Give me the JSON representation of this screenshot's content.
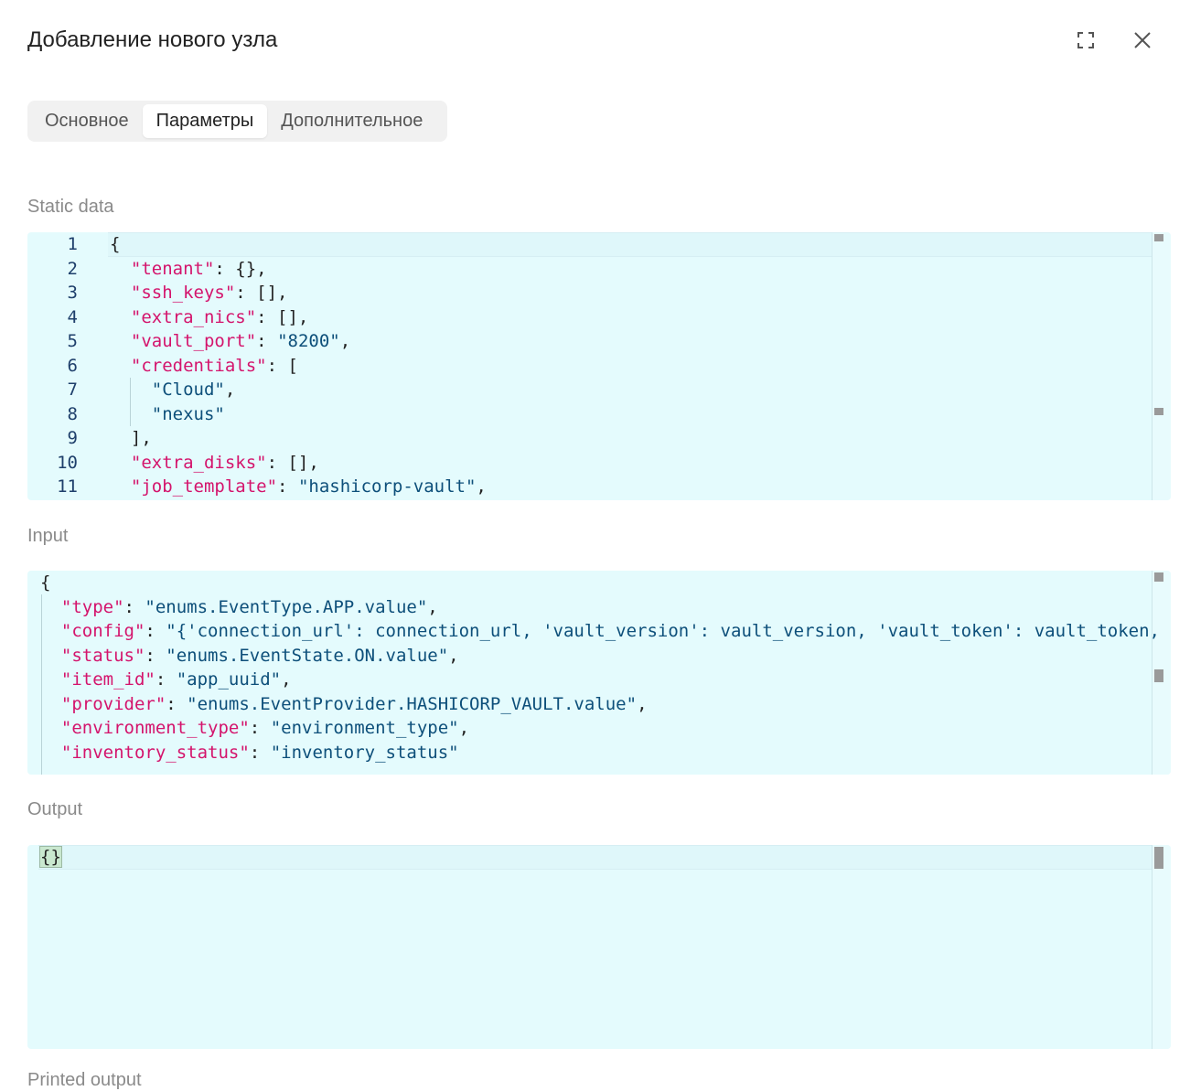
{
  "dialog": {
    "title": "Добавление нового узла",
    "icons": {
      "fullscreen": "fullscreen-icon",
      "close": "close-icon"
    }
  },
  "tabs": [
    {
      "label": "Основное",
      "active": false
    },
    {
      "label": "Параметры",
      "active": true
    },
    {
      "label": "Дополнительное",
      "active": false
    }
  ],
  "sections": {
    "static_data": {
      "label": "Static data",
      "line_numbers": [
        "1",
        "2",
        "3",
        "4",
        "5",
        "6",
        "7",
        "8",
        "9",
        "10",
        "11"
      ],
      "lines": [
        {
          "indent": "",
          "parts": [
            [
              "p",
              "{"
            ]
          ]
        },
        {
          "indent": "  ",
          "parts": [
            [
              "k",
              "\"tenant\""
            ],
            [
              "p",
              ": {},"
            ]
          ]
        },
        {
          "indent": "  ",
          "parts": [
            [
              "k",
              "\"ssh_keys\""
            ],
            [
              "p",
              ": [],"
            ]
          ]
        },
        {
          "indent": "  ",
          "parts": [
            [
              "k",
              "\"extra_nics\""
            ],
            [
              "p",
              ": [],"
            ]
          ]
        },
        {
          "indent": "  ",
          "parts": [
            [
              "k",
              "\"vault_port\""
            ],
            [
              "p",
              ": "
            ],
            [
              "s",
              "\"8200\""
            ],
            [
              "p",
              ","
            ]
          ]
        },
        {
          "indent": "  ",
          "parts": [
            [
              "k",
              "\"credentials\""
            ],
            [
              "p",
              ": ["
            ]
          ]
        },
        {
          "indent": "    ",
          "parts": [
            [
              "s",
              "\"Cloud\""
            ],
            [
              "p",
              ","
            ]
          ]
        },
        {
          "indent": "    ",
          "parts": [
            [
              "s",
              "\"nexus\""
            ]
          ]
        },
        {
          "indent": "  ",
          "parts": [
            [
              "p",
              "],"
            ]
          ]
        },
        {
          "indent": "  ",
          "parts": [
            [
              "k",
              "\"extra_disks\""
            ],
            [
              "p",
              ": [],"
            ]
          ]
        },
        {
          "indent": "  ",
          "parts": [
            [
              "k",
              "\"job_template\""
            ],
            [
              "p",
              ": "
            ],
            [
              "s",
              "\"hashicorp-vault\""
            ],
            [
              "p",
              ","
            ]
          ]
        }
      ]
    },
    "input": {
      "label": "Input",
      "lines": [
        {
          "indent": "",
          "parts": [
            [
              "p",
              "{"
            ]
          ]
        },
        {
          "indent": "  ",
          "parts": [
            [
              "k",
              "\"type\""
            ],
            [
              "p",
              ": "
            ],
            [
              "s",
              "\"enums.EventType.APP.value\""
            ],
            [
              "p",
              ","
            ]
          ]
        },
        {
          "indent": "  ",
          "parts": [
            [
              "k",
              "\"config\""
            ],
            [
              "p",
              ": "
            ],
            [
              "s",
              "\"{'connection_url': connection_url, 'vault_version': vault_version, 'vault_token': vault_token, 'vault_"
            ]
          ]
        },
        {
          "indent": "  ",
          "parts": [
            [
              "k",
              "\"status\""
            ],
            [
              "p",
              ": "
            ],
            [
              "s",
              "\"enums.EventState.ON.value\""
            ],
            [
              "p",
              ","
            ]
          ]
        },
        {
          "indent": "  ",
          "parts": [
            [
              "k",
              "\"item_id\""
            ],
            [
              "p",
              ": "
            ],
            [
              "s",
              "\"app_uuid\""
            ],
            [
              "p",
              ","
            ]
          ]
        },
        {
          "indent": "  ",
          "parts": [
            [
              "k",
              "\"provider\""
            ],
            [
              "p",
              ": "
            ],
            [
              "s",
              "\"enums.EventProvider.HASHICORP_VAULT.value\""
            ],
            [
              "p",
              ","
            ]
          ]
        },
        {
          "indent": "  ",
          "parts": [
            [
              "k",
              "\"environment_type\""
            ],
            [
              "p",
              ": "
            ],
            [
              "s",
              "\"environment_type\""
            ],
            [
              "p",
              ","
            ]
          ]
        },
        {
          "indent": "  ",
          "parts": [
            [
              "k",
              "\"inventory_status\""
            ],
            [
              "p",
              ": "
            ],
            [
              "s",
              "\"inventory_status\""
            ]
          ]
        }
      ]
    },
    "output": {
      "label": "Output",
      "lines": [
        {
          "indent": "",
          "parts": [
            [
              "p",
              "{}"
            ]
          ]
        }
      ]
    },
    "next_label": "Printed output"
  }
}
